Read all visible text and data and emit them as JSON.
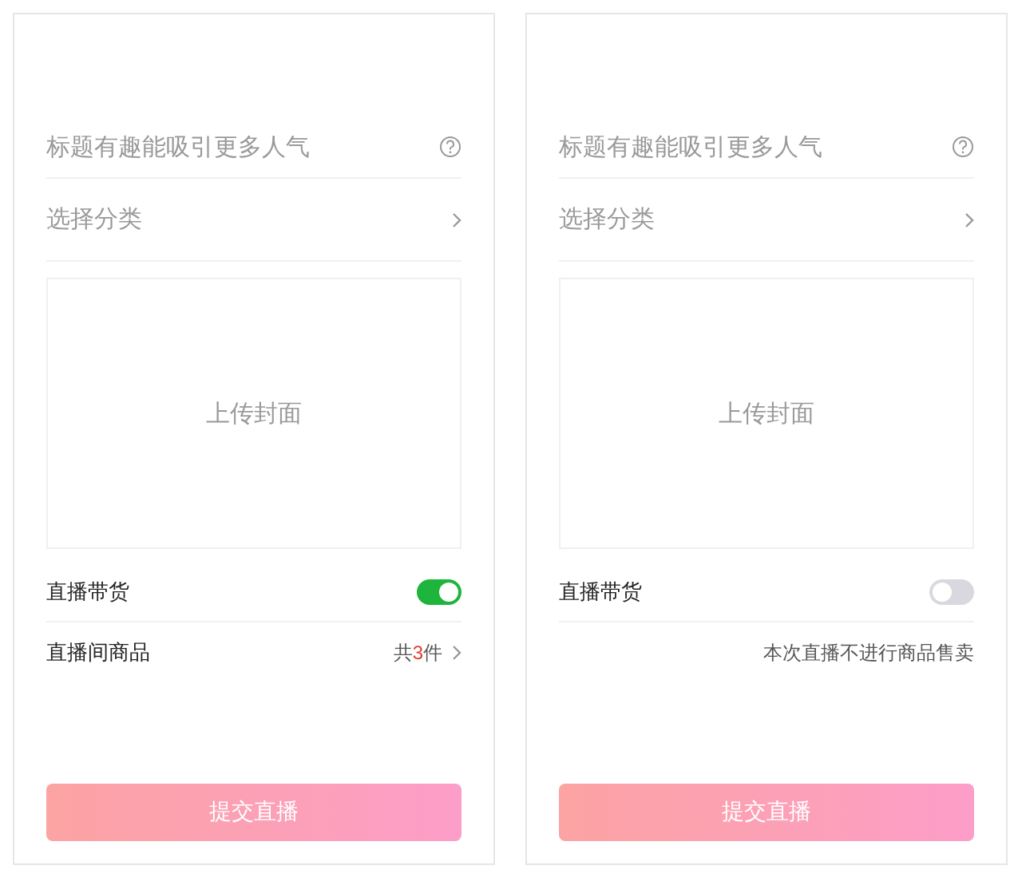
{
  "screens": [
    {
      "title_field": {
        "placeholder": "标题有趣能吸引更多人气"
      },
      "category": {
        "label": "选择分类"
      },
      "cover_upload": {
        "label": "上传封面"
      },
      "live_selling": {
        "label": "直播带货",
        "on": true
      },
      "goods": {
        "kind": "count",
        "label": "直播间商品",
        "prefix": "共",
        "count": "3",
        "suffix": "件"
      },
      "submit_button": "提交直播"
    },
    {
      "title_field": {
        "placeholder": "标题有趣能吸引更多人气"
      },
      "category": {
        "label": "选择分类"
      },
      "cover_upload": {
        "label": "上传封面"
      },
      "live_selling": {
        "label": "直播带货",
        "on": false
      },
      "goods": {
        "kind": "note",
        "note": "本次直播不进行商品售卖"
      },
      "submit_button": "提交直播"
    }
  ]
}
